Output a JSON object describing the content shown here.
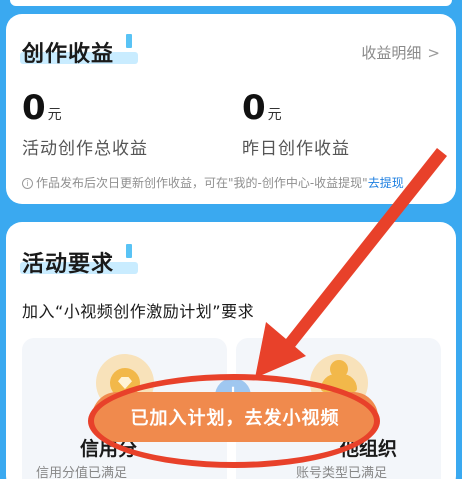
{
  "earnings": {
    "title": "创作收益",
    "details_link": "收益明细",
    "details_chevron": ">",
    "total": {
      "value": "0",
      "unit": "元",
      "label": "活动创作总收益"
    },
    "yesterday": {
      "value": "0",
      "unit": "元",
      "label": "昨日创作收益"
    },
    "note_icon": "i",
    "note_text": "作品发布后次日更新创作收益，可在\"我的-创作中心-收益提现\"",
    "note_link": "去提现"
  },
  "requirements": {
    "title": "活动要求",
    "subtitle": "加入“小视频创作激励计划”要求",
    "boxes": [
      {
        "icon": "gem-badge-icon",
        "title": "信用分",
        "desc": "信用分值已满足"
      },
      {
        "icon": "person-badge-icon",
        "title": "他组织",
        "desc": "账号类型已满足"
      }
    ]
  },
  "plus_symbol": "+",
  "cta_label": "已加入计划，去发小视频",
  "colors": {
    "page_background": "#3aa9f0",
    "cta": "#f08a4d",
    "annotation_red": "#e8412a",
    "link_blue": "#1e7fe0"
  }
}
